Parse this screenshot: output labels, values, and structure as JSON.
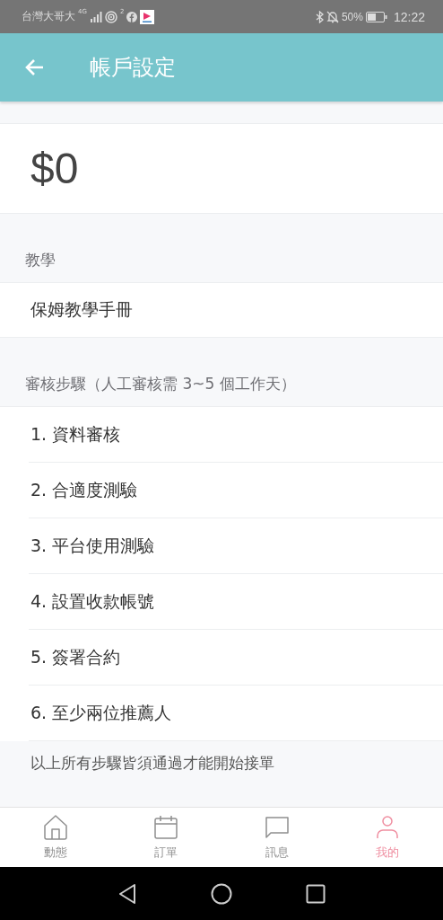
{
  "status_bar": {
    "carrier": "台灣大哥大",
    "network": "4G",
    "hotspot_count": "2",
    "battery": "50%",
    "time": "12:22"
  },
  "app_bar": {
    "title": "帳戶設定"
  },
  "balance": {
    "amount": "$0"
  },
  "tutorial": {
    "header": "教學",
    "items": [
      "保姆教學手冊"
    ]
  },
  "review": {
    "header": "審核步驟（人工審核需 3~5 個工作天）",
    "steps": [
      "1. 資料審核",
      "2. 合適度測驗",
      "3. 平台使用測驗",
      "4. 設置收款帳號",
      "5. 簽署合約",
      "6. 至少兩位推薦人"
    ],
    "note": "以上所有步驟皆須通過才能開始接單"
  },
  "bottom_nav": [
    {
      "label": "動態",
      "kind": "home",
      "selected": false
    },
    {
      "label": "訂單",
      "kind": "calendar",
      "selected": false
    },
    {
      "label": "訊息",
      "kind": "chat",
      "selected": false
    },
    {
      "label": "我的",
      "kind": "person",
      "selected": true
    }
  ]
}
